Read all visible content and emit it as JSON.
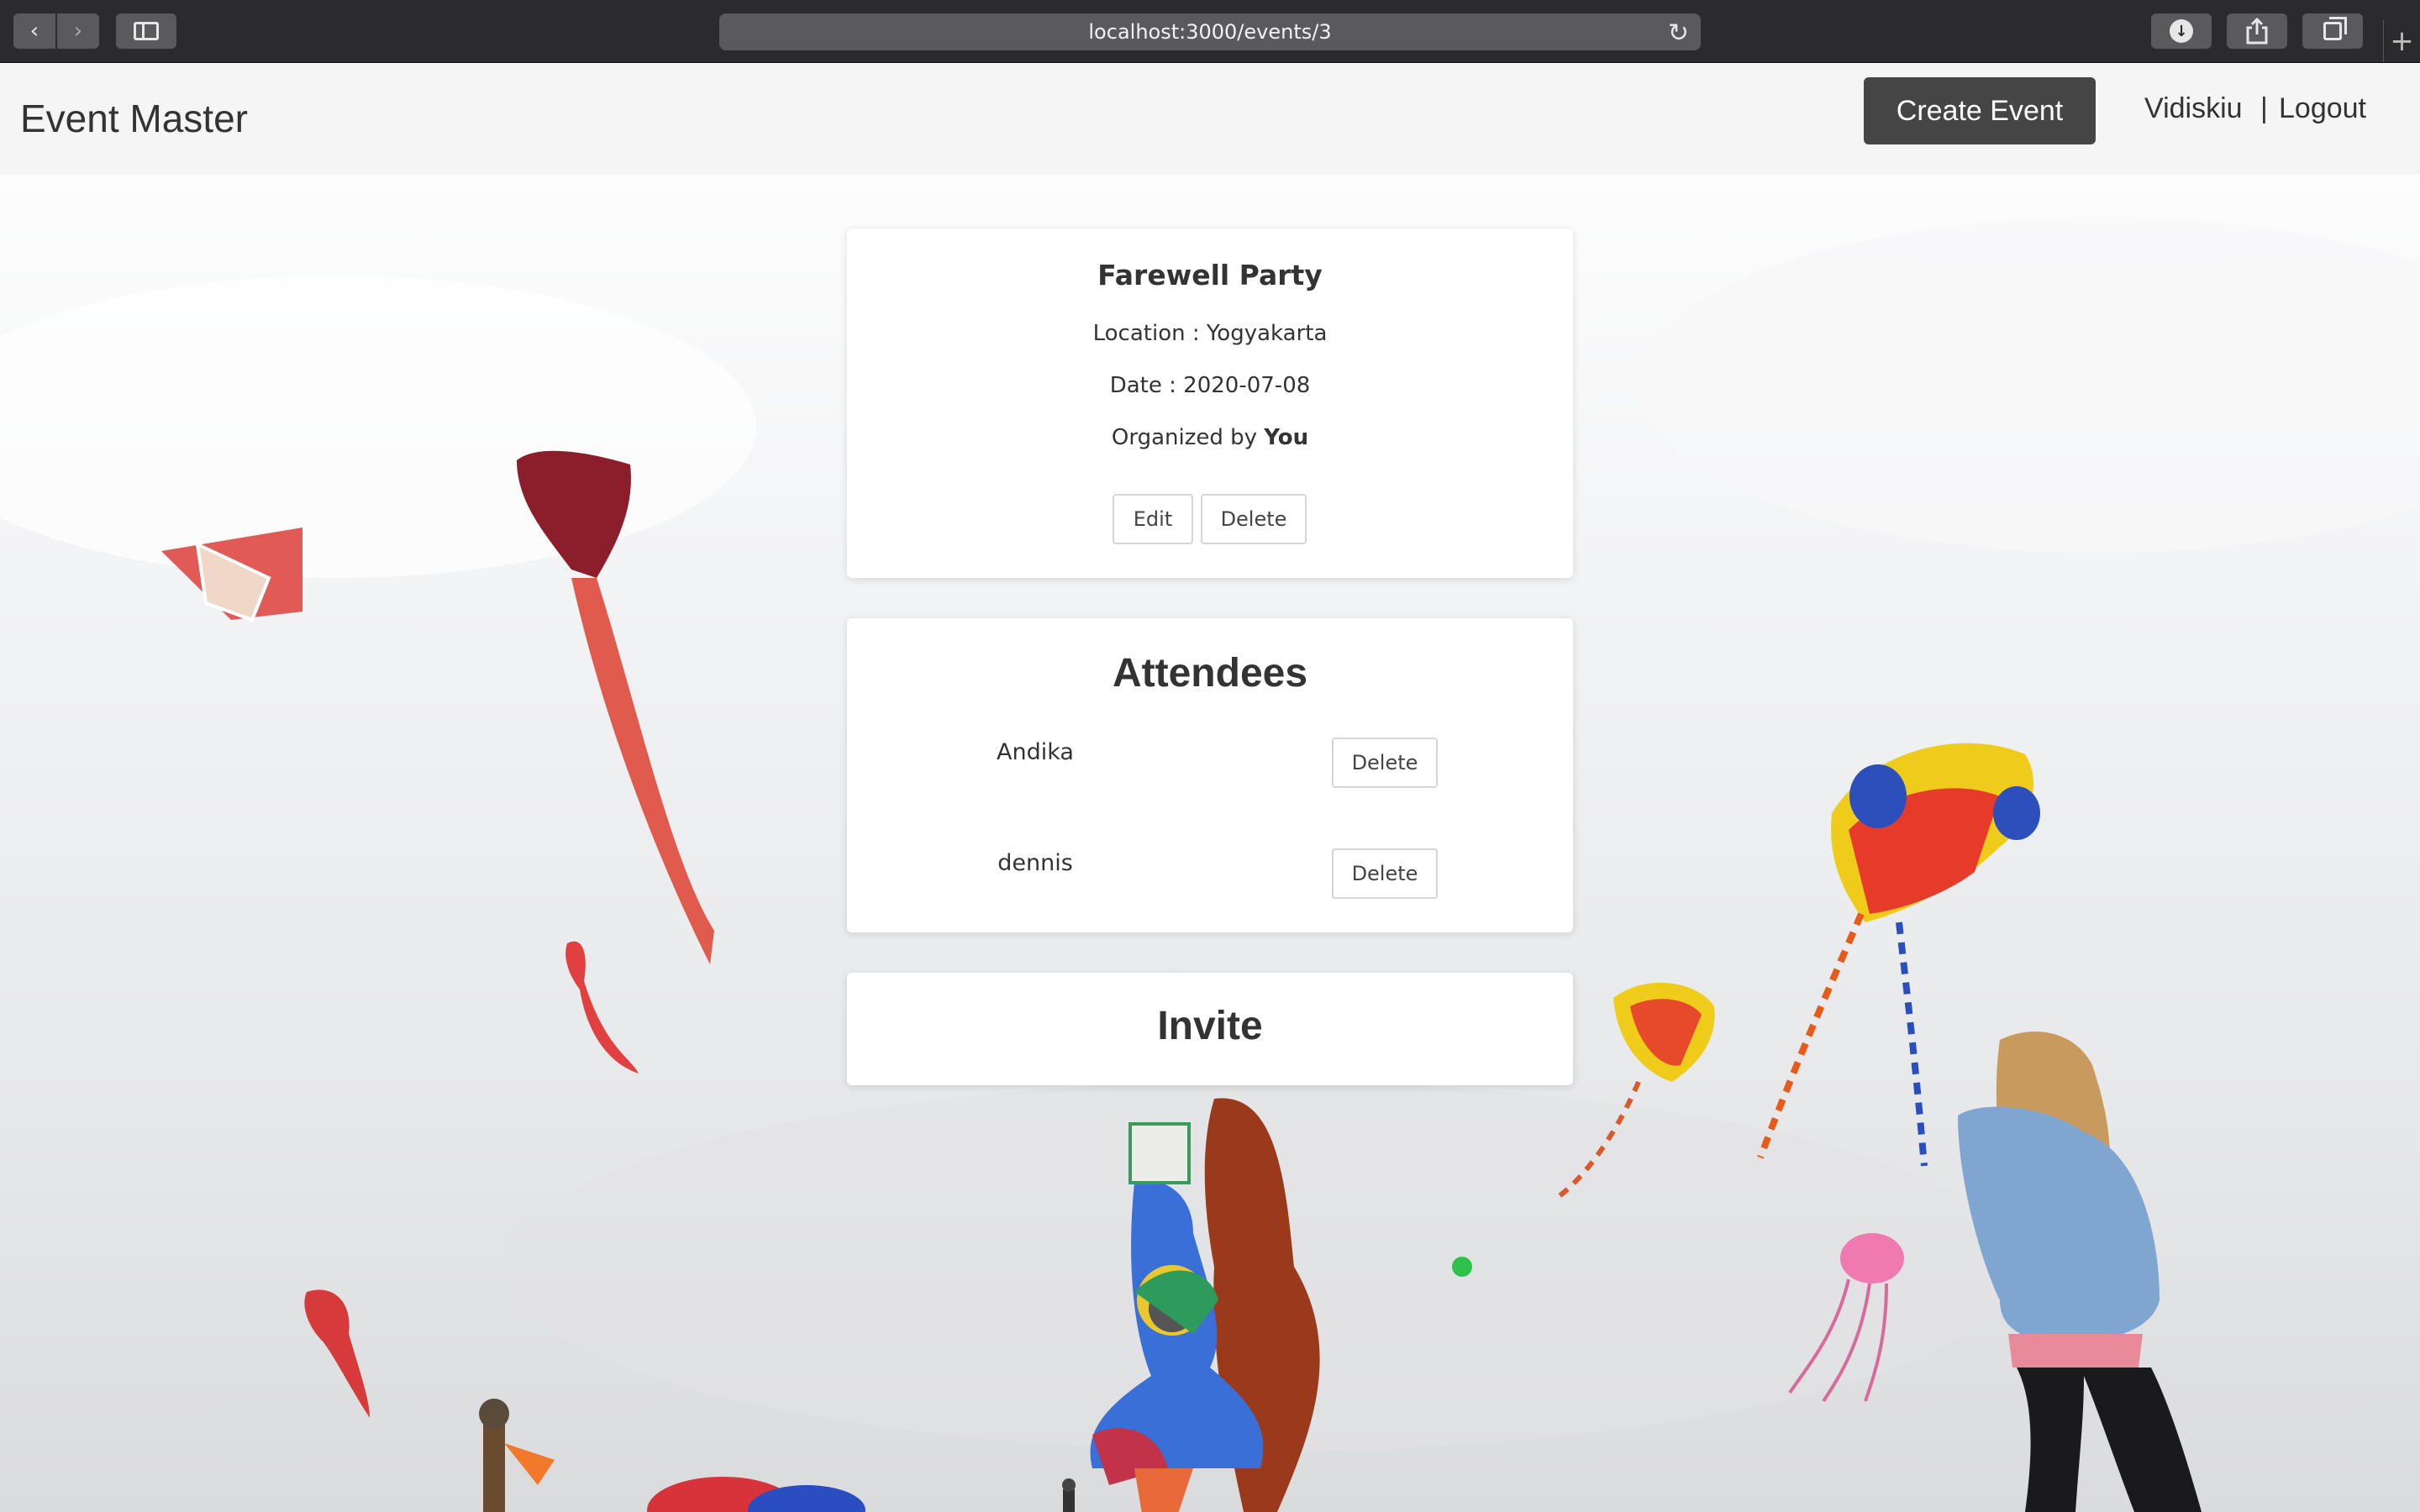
{
  "browser": {
    "url": "localhost:3000/events/3",
    "back_icon": "‹",
    "forward_icon": "›",
    "reload_icon": "↻",
    "new_tab_icon": "+"
  },
  "navbar": {
    "brand": "Event Master",
    "create_event_label": "Create Event",
    "username": "Vidiskiu",
    "separator": "|",
    "logout_label": "Logout"
  },
  "event": {
    "title": "Farewell Party",
    "location_label": "Location",
    "location_sep": ":",
    "location": "Yogyakarta",
    "date_label": "Date",
    "date_sep": ":",
    "date": "2020-07-08",
    "organized_prefix": "Organized by",
    "organizer": "You",
    "edit_label": "Edit",
    "delete_label": "Delete"
  },
  "attendees": {
    "title": "Attendees",
    "list": [
      {
        "name": "Andika",
        "delete_label": "Delete"
      },
      {
        "name": "dennis",
        "delete_label": "Delete"
      }
    ]
  },
  "invite": {
    "title": "Invite"
  },
  "colors": {
    "navbar_bg": "#f5f5f5",
    "create_btn_bg": "#454545",
    "chrome_bg": "#2b2b2d"
  }
}
